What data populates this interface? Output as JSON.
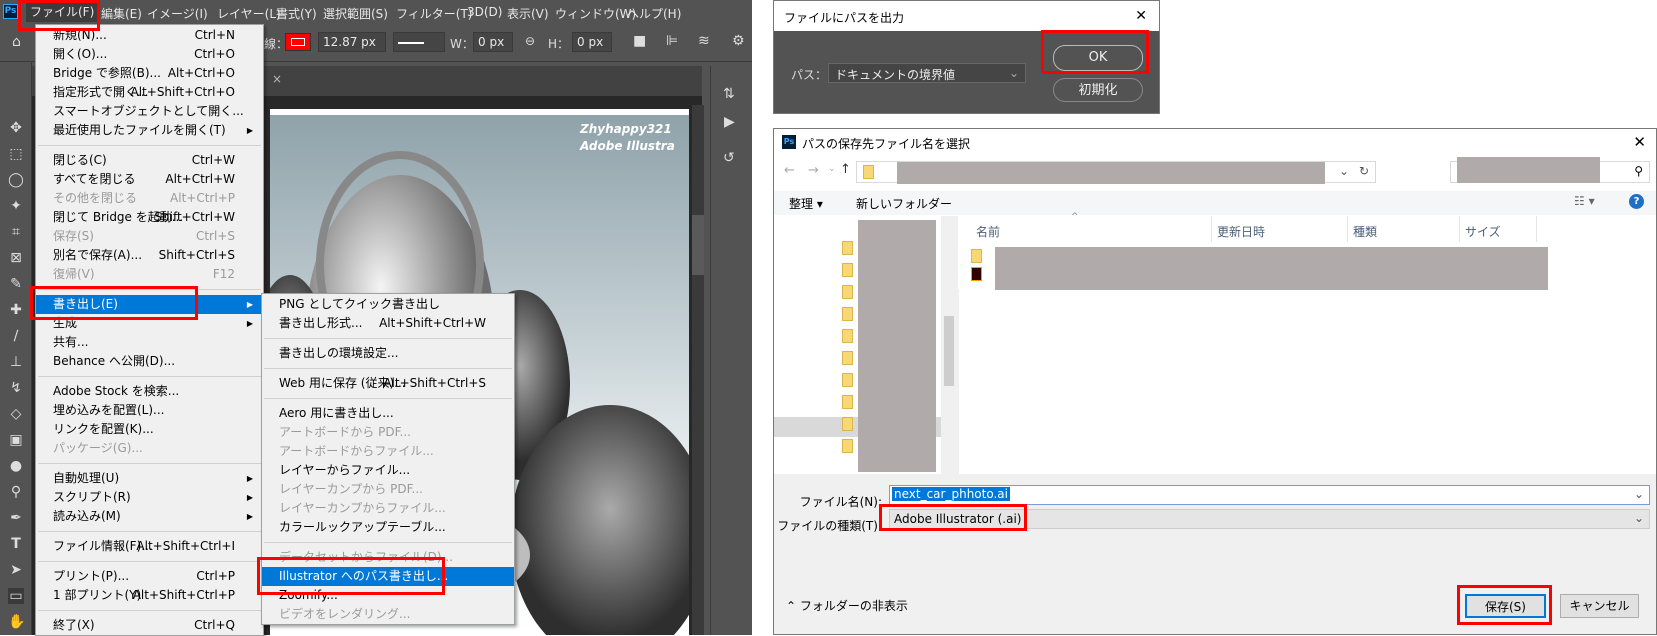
{
  "menubar": {
    "logo": "Ps",
    "items": [
      "ファイル(F)",
      "編集(E)",
      "イメージ(I)",
      "レイヤー(L)",
      "書式(Y)",
      "選択範囲(S)",
      "フィルター(T)",
      "3D(D)",
      "表示(V)",
      "ウィンドウ(W)",
      "ヘルプ(H)"
    ]
  },
  "options": {
    "stroke_label": "線：",
    "stroke_width": "12.87 px",
    "w_label": "W：",
    "w_value": "0 px",
    "h_label": "H：",
    "h_value": "0 px",
    "stroke_color": "#ff0000"
  },
  "canvas": {
    "watermark_line1": "Zhyhappy321",
    "watermark_line2": "Adobe Illustra"
  },
  "file_menu": [
    {
      "label": "新規(N)...",
      "shortcut": "Ctrl+N"
    },
    {
      "label": "開く(O)...",
      "shortcut": "Ctrl+O"
    },
    {
      "label": "Bridge で参照(B)...",
      "shortcut": "Alt+Ctrl+O"
    },
    {
      "label": "指定形式で開く...",
      "shortcut": "Alt+Shift+Ctrl+O"
    },
    {
      "label": "スマートオブジェクトとして開く..."
    },
    {
      "label": "最近使用したファイルを開く(T)",
      "submenu": true
    },
    {
      "sep": true
    },
    {
      "label": "閉じる(C)",
      "shortcut": "Ctrl+W"
    },
    {
      "label": "すべてを閉じる",
      "shortcut": "Alt+Ctrl+W"
    },
    {
      "label": "その他を閉じる",
      "shortcut": "Alt+Ctrl+P",
      "disabled": true
    },
    {
      "label": "閉じて Bridge を起動...",
      "shortcut": "Shift+Ctrl+W"
    },
    {
      "label": "保存(S)",
      "shortcut": "Ctrl+S",
      "disabled": true
    },
    {
      "label": "別名で保存(A)...",
      "shortcut": "Shift+Ctrl+S"
    },
    {
      "label": "復帰(V)",
      "shortcut": "F12",
      "disabled": true
    },
    {
      "sep": true
    },
    {
      "label": "書き出し(E)",
      "submenu": true,
      "selected": true
    },
    {
      "label": "生成",
      "submenu": true
    },
    {
      "label": "共有..."
    },
    {
      "label": "Behance へ公開(D)..."
    },
    {
      "sep": true
    },
    {
      "label": "Adobe Stock を検索..."
    },
    {
      "label": "埋め込みを配置(L)..."
    },
    {
      "label": "リンクを配置(K)..."
    },
    {
      "label": "パッケージ(G)...",
      "disabled": true
    },
    {
      "sep": true
    },
    {
      "label": "自動処理(U)",
      "submenu": true
    },
    {
      "label": "スクリプト(R)",
      "submenu": true
    },
    {
      "label": "読み込み(M)",
      "submenu": true
    },
    {
      "sep": true
    },
    {
      "label": "ファイル情報(F)...",
      "shortcut": "Alt+Shift+Ctrl+I"
    },
    {
      "sep": true
    },
    {
      "label": "プリント(P)...",
      "shortcut": "Ctrl+P"
    },
    {
      "label": "1 部プリント(Y)",
      "shortcut": "Alt+Shift+Ctrl+P"
    },
    {
      "sep": true
    },
    {
      "label": "終了(X)",
      "shortcut": "Ctrl+Q"
    }
  ],
  "export_submenu": [
    {
      "label": "PNG としてクイック書き出し"
    },
    {
      "label": "書き出し形式...",
      "shortcut": "Alt+Shift+Ctrl+W"
    },
    {
      "sep": true
    },
    {
      "label": "書き出しの環境設定..."
    },
    {
      "sep": true
    },
    {
      "label": "Web 用に保存 (従来)...",
      "shortcut": "Alt+Shift+Ctrl+S"
    },
    {
      "sep": true
    },
    {
      "label": "Aero 用に書き出し..."
    },
    {
      "label": "アートボードから PDF...",
      "disabled": true
    },
    {
      "label": "アートボードからファイル...",
      "disabled": true
    },
    {
      "label": "レイヤーからファイル..."
    },
    {
      "label": "レイヤーカンプから PDF...",
      "disabled": true
    },
    {
      "label": "レイヤーカンプからファイル...",
      "disabled": true
    },
    {
      "label": "カラールックアップテーブル..."
    },
    {
      "sep": true
    },
    {
      "label": "データセットからファイル(D)...",
      "disabled": true
    },
    {
      "label": "Illustrator へのパス書き出し...",
      "selected": true
    },
    {
      "label": "Zoomify..."
    },
    {
      "label": "ビデオをレンダリング...",
      "disabled": true
    }
  ],
  "path_dialog": {
    "title": "ファイルにパスを出力",
    "close": "✕",
    "path_label": "パス：",
    "path_value": "ドキュメントの境界値",
    "ok": "OK",
    "reset": "初期化"
  },
  "save_dialog": {
    "title": "パスの保存先ファイル名を選択",
    "close": "✕",
    "app_icon": "Ps",
    "organize": "整理 ▾",
    "new_folder": "新しいフォルダー",
    "columns": [
      "名前",
      "更新日時",
      "種類",
      "サイズ"
    ],
    "filename_label": "ファイル名(N):",
    "filename_value": "next_car_phhoto.ai",
    "filetype_label": "ファイルの種類(T):",
    "filetype_value": "Adobe Illustrator (.ai)",
    "hide_folders": "フォルダーの非表示",
    "save": "保存(S)",
    "cancel": "キャンセル"
  },
  "highlight_color": "#ff0000",
  "selection_color": "#0078d7"
}
